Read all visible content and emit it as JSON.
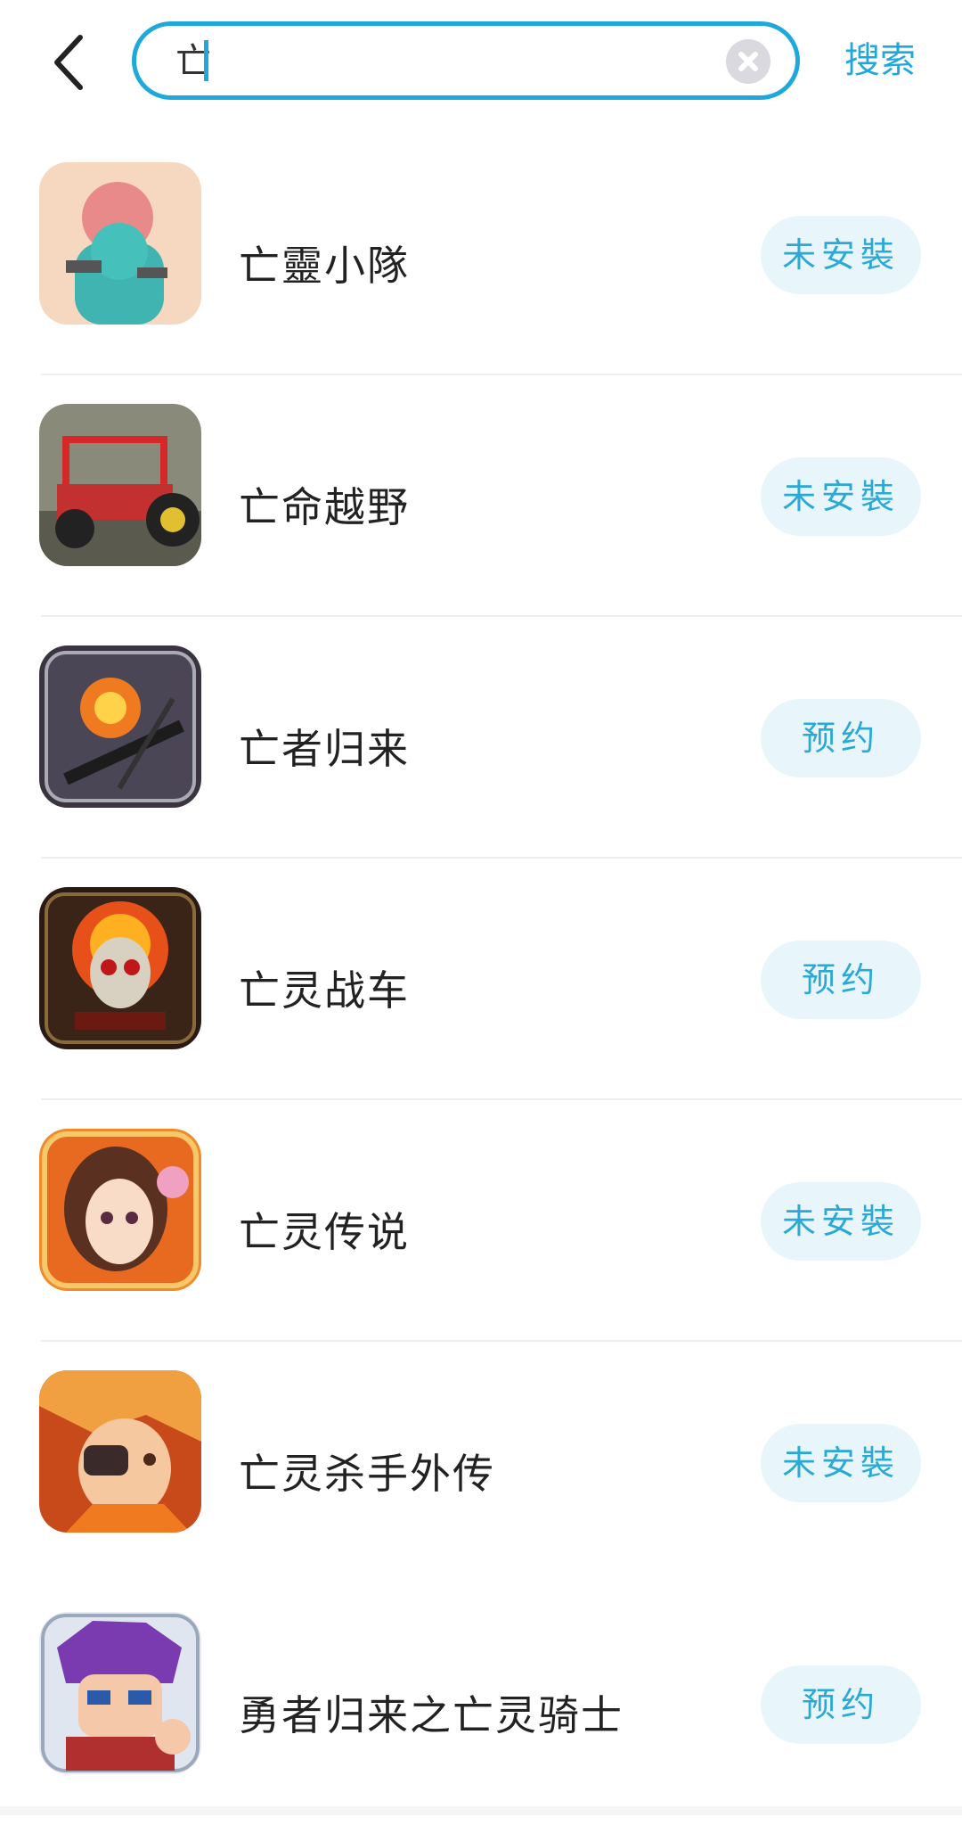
{
  "search": {
    "query": "亡",
    "action_label": "搜索"
  },
  "results": [
    {
      "name": "亡靈小隊",
      "status": "未安裝"
    },
    {
      "name": "亡命越野",
      "status": "未安裝"
    },
    {
      "name": "亡者归来",
      "status": "预约"
    },
    {
      "name": "亡灵战车",
      "status": "预约"
    },
    {
      "name": "亡灵传说",
      "status": "未安裝"
    },
    {
      "name": "亡灵杀手外传",
      "status": "未安裝"
    },
    {
      "name": "勇者归来之亡灵骑士",
      "status": "预约"
    }
  ],
  "colors": {
    "accent": "#1ea8dc",
    "pill_bg": "#e8f6fc",
    "pill_text": "#2aa8d6"
  }
}
